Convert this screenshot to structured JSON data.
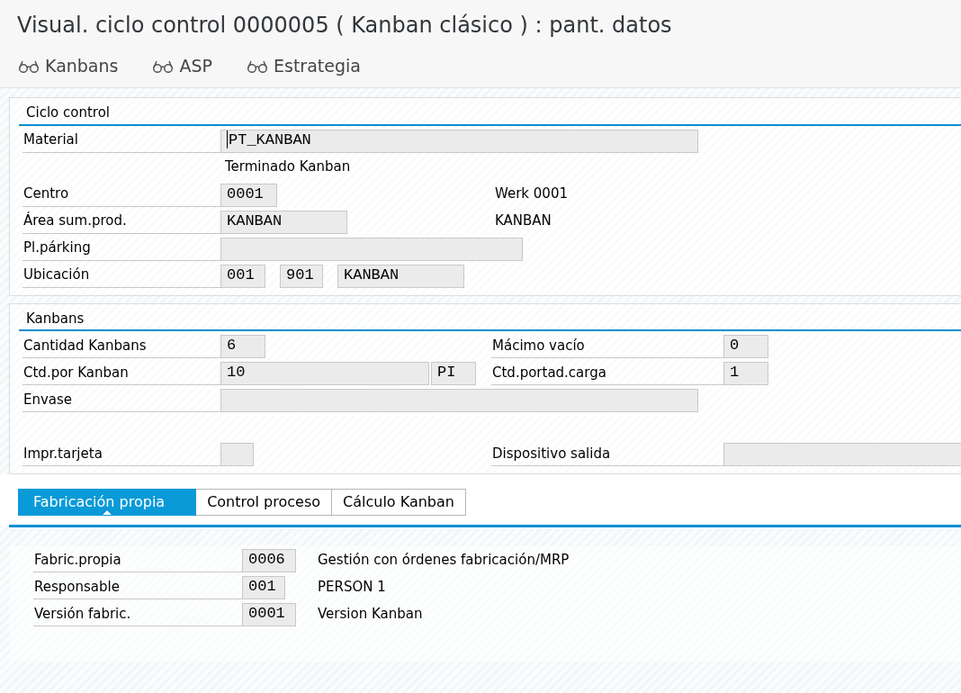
{
  "window": {
    "title": "Visual. ciclo control 0000005 ( Kanban clásico ) : pant. datos"
  },
  "toolbar": [
    {
      "label": "Kanbans"
    },
    {
      "label": "ASP"
    },
    {
      "label": "Estrategia"
    }
  ],
  "ciclo_control": {
    "title": "Ciclo control",
    "rows": [
      {
        "label": "Material",
        "fields": [
          {
            "value": "PT_KANBAN",
            "focused": true
          }
        ],
        "note": "Terminado Kanban"
      },
      {
        "label": "Centro",
        "fields": [
          {
            "value": "0001",
            "focused": false
          }
        ],
        "description": "Werk 0001"
      },
      {
        "label": "Área sum.prod.",
        "fields": [
          {
            "value": "KANBAN",
            "focused": false
          }
        ],
        "description": "KANBAN"
      },
      {
        "label": "Pl.párking",
        "fields": [
          {
            "focused": false
          }
        ]
      },
      {
        "label": "Ubicación",
        "fields": [
          {
            "value": "001",
            "focused": false
          },
          {
            "value": "901",
            "focused": false
          },
          {
            "value": "KANBAN",
            "focused": false
          }
        ]
      }
    ]
  },
  "kanbans": {
    "title": "Kanbans",
    "rows": [
      {
        "label": "Cantidad Kanbans",
        "fields": [
          {
            "value": "6",
            "focused": false
          }
        ],
        "right": {
          "label": "Mácimo vacío",
          "fields": [
            {
              "value": "0",
              "focused": false
            }
          ]
        }
      },
      {
        "label": "Ctd.por Kanban",
        "fields": [
          {
            "value": "10",
            "focused": false
          },
          {
            "value": "PI",
            "focused": false
          }
        ],
        "right": {
          "label": "Ctd.portad.carga",
          "fields": [
            {
              "value": "1",
              "focused": false
            }
          ]
        }
      },
      {
        "label": "Envase",
        "fields": [
          {
            "focused": false
          }
        ]
      },
      {
        "label": "Impr.tarjeta",
        "fields": [
          {
            "focused": false
          }
        ],
        "right": {
          "label": "Dispositivo salida",
          "fields": [
            {
              "focused": false
            }
          ]
        }
      }
    ]
  },
  "tabs": [
    {
      "label": "Fabricación propia",
      "selected": true
    },
    {
      "label": "Control proceso",
      "selected": false
    },
    {
      "label": "Cálculo Kanban",
      "selected": false
    }
  ],
  "tab_content": {
    "rows": [
      {
        "label": "Fabric.propia",
        "fields": [
          {
            "value": "0006",
            "focused": false
          }
        ],
        "description": "Gestión con órdenes fabricación/MRP"
      },
      {
        "label": "Responsable",
        "fields": [
          {
            "value": "001",
            "focused": false
          }
        ],
        "description": "PERSON 1"
      },
      {
        "label": "Versión fabric.",
        "fields": [
          {
            "value": "0001",
            "focused": false
          }
        ],
        "description": "Version Kanban"
      }
    ]
  }
}
